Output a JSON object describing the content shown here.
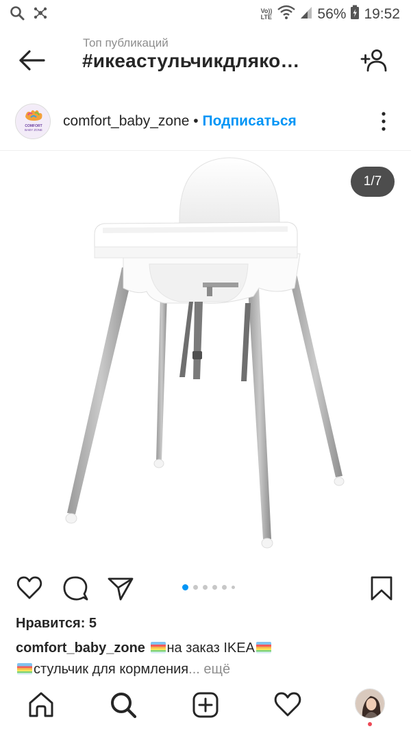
{
  "status_bar": {
    "volte_line1": "Vo))",
    "volte_line2": "LTE",
    "battery_percent": "56%",
    "time": "19:52",
    "icons": [
      "search-icon",
      "nodes-icon",
      "wifi-icon",
      "signal-icon",
      "battery-icon"
    ]
  },
  "header": {
    "subtitle": "Топ публикаций",
    "title": "#икеастульчикдляко…",
    "icons": [
      "arrow-left-icon",
      "add-user-icon"
    ]
  },
  "post": {
    "username": "comfort_baby_zone",
    "separator": "•",
    "follow_label": "Подписаться",
    "avatar_text_line1": "COMFORT",
    "avatar_text_line2": "BABY ZONE",
    "counter": "1/7",
    "carousel": {
      "total": 7,
      "current": 1
    }
  },
  "actions": {
    "icons": [
      "heart-icon",
      "comment-icon",
      "share-icon",
      "bookmark-icon"
    ]
  },
  "likes": "Нравится: 5",
  "caption": {
    "username": "comfort_baby_zone",
    "text1": "на заказ IKEA",
    "text2": "стульчик для кормления",
    "more": "... ещё"
  },
  "bottom_nav": {
    "icons": [
      "home-icon",
      "search-icon",
      "add-post-icon",
      "activity-heart-icon",
      "profile-avatar"
    ]
  },
  "colors": {
    "accent": "#0095f6",
    "text": "#262626",
    "secondary": "#8e8e8e",
    "notification": "#ed4956"
  }
}
